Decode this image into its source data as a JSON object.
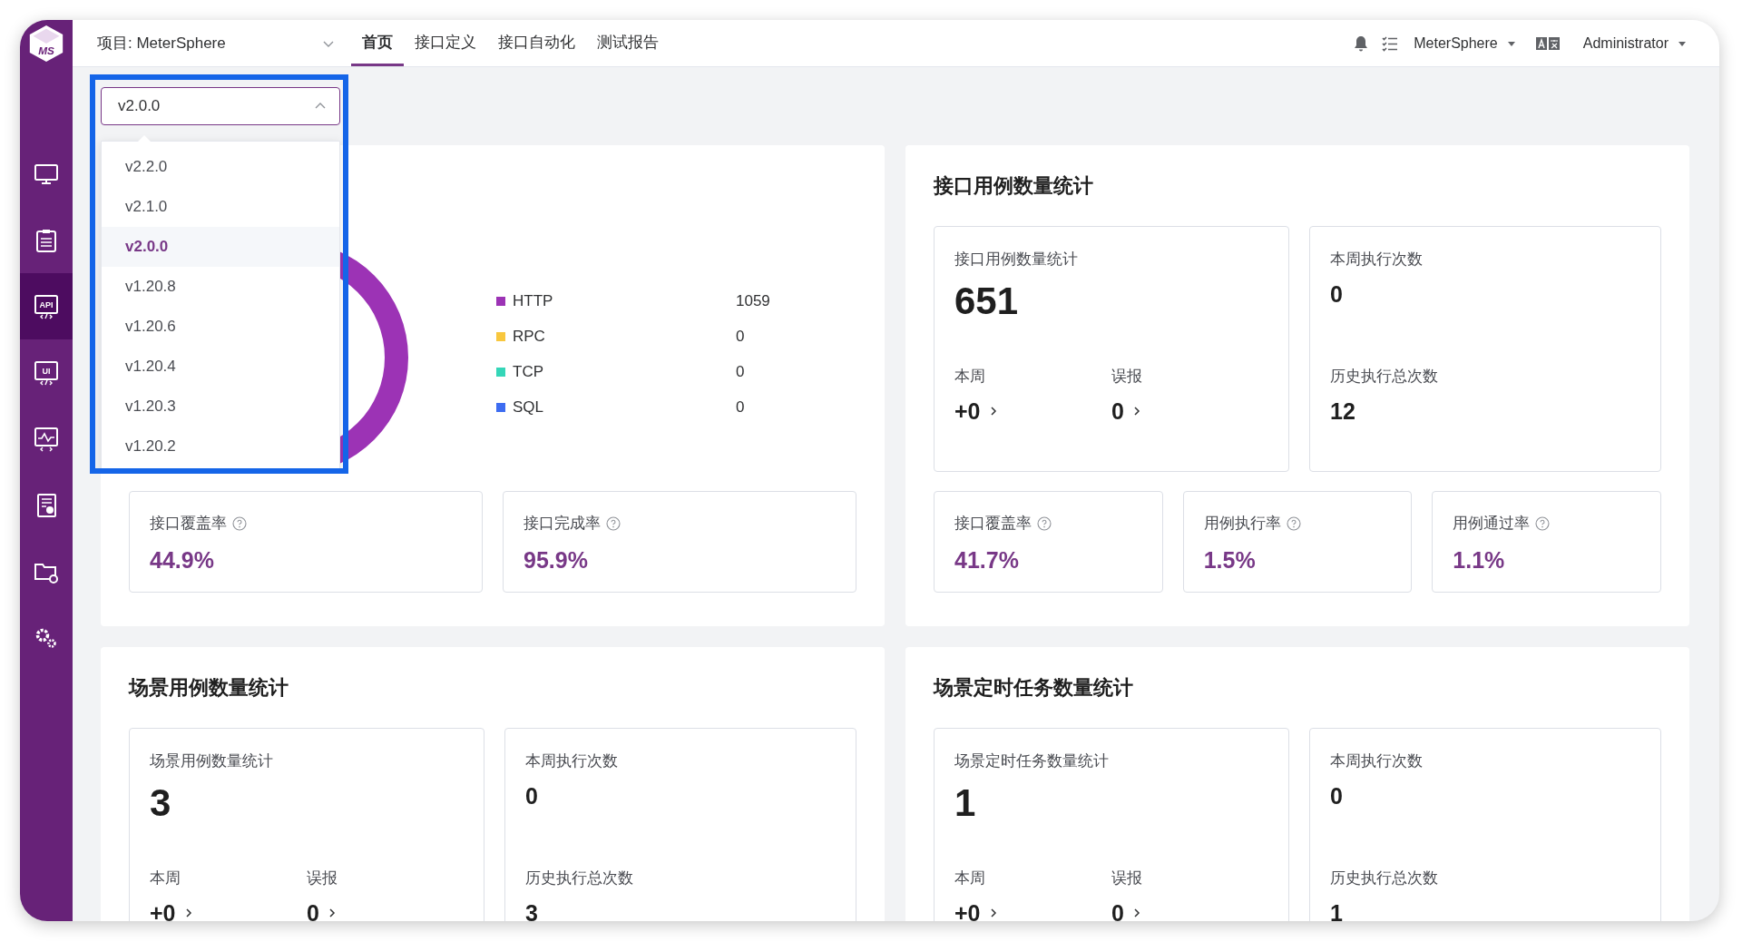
{
  "logo": {
    "text": "MS"
  },
  "sidebar": {
    "items": [
      {
        "kind": "monitor",
        "selected": false
      },
      {
        "kind": "clipboard",
        "selected": false
      },
      {
        "kind": "code-screen",
        "label": "API",
        "selected": true
      },
      {
        "kind": "code-screen",
        "label": "UI",
        "selected": false
      },
      {
        "kind": "chart-screen",
        "selected": false
      },
      {
        "kind": "report",
        "selected": false
      },
      {
        "kind": "folder-gear",
        "selected": false
      },
      {
        "kind": "gears",
        "selected": false
      }
    ]
  },
  "project_selector": {
    "label": "项目: MeterSphere"
  },
  "tabs": [
    {
      "label": "首页",
      "selected": true
    },
    {
      "label": "接口定义",
      "selected": false
    },
    {
      "label": "接口自动化",
      "selected": false
    },
    {
      "label": "测试报告",
      "selected": false
    }
  ],
  "header_right": {
    "workspace": "MeterSphere",
    "user": "Administrator"
  },
  "version_select": {
    "value": "v2.0.0",
    "options": [
      {
        "label": "v2.2.0",
        "selected": false
      },
      {
        "label": "v2.1.0",
        "selected": false
      },
      {
        "label": "v2.0.0",
        "selected": true
      },
      {
        "label": "v1.20.8",
        "selected": false
      },
      {
        "label": "v1.20.6",
        "selected": false
      },
      {
        "label": "v1.20.4",
        "selected": false
      },
      {
        "label": "v1.20.3",
        "selected": false
      },
      {
        "label": "v1.20.2",
        "selected": false
      }
    ]
  },
  "panels": [
    {
      "kind": "chart",
      "legend": [
        {
          "name": "HTTP",
          "count": "1059",
          "color": "#9c33b5"
        },
        {
          "name": "RPC",
          "count": "0",
          "color": "#f8c73e"
        },
        {
          "name": "TCP",
          "count": "0",
          "color": "#35d6b8"
        },
        {
          "name": "SQL",
          "count": "0",
          "color": "#3d6cf1"
        }
      ],
      "rates": [
        {
          "label": "接口覆盖率",
          "value": "44.9%"
        },
        {
          "label": "接口完成率",
          "value": "95.9%"
        }
      ]
    },
    {
      "kind": "stats",
      "title": "接口用例数量统计",
      "summary": {
        "label": "接口用例数量统计",
        "total": "651",
        "week_label": "本周",
        "week_value": "+0",
        "false_label": "误报",
        "false_value": "0"
      },
      "execution": {
        "week_label": "本周执行次数",
        "week_value": "0",
        "history_label": "历史执行总次数",
        "history_value": "12"
      },
      "rates": [
        {
          "label": "接口覆盖率",
          "value": "41.7%"
        },
        {
          "label": "用例执行率",
          "value": "1.5%"
        },
        {
          "label": "用例通过率",
          "value": "1.1%"
        }
      ]
    },
    {
      "kind": "stats",
      "title": "场景用例数量统计",
      "summary": {
        "label": "场景用例数量统计",
        "total": "3",
        "week_label": "本周",
        "week_value": "+0",
        "false_label": "误报",
        "false_value": "0"
      },
      "execution": {
        "week_label": "本周执行次数",
        "week_value": "0",
        "history_label": "历史执行总次数",
        "history_value": "3"
      }
    },
    {
      "kind": "stats",
      "title": "场景定时任务数量统计",
      "summary": {
        "label": "场景定时任务数量统计",
        "total": "1",
        "week_label": "本周",
        "week_value": "+0",
        "false_label": "误报",
        "false_value": "0"
      },
      "execution": {
        "week_label": "本周执行次数",
        "week_value": "0",
        "history_label": "历史执行总次数",
        "history_value": "1"
      }
    }
  ]
}
